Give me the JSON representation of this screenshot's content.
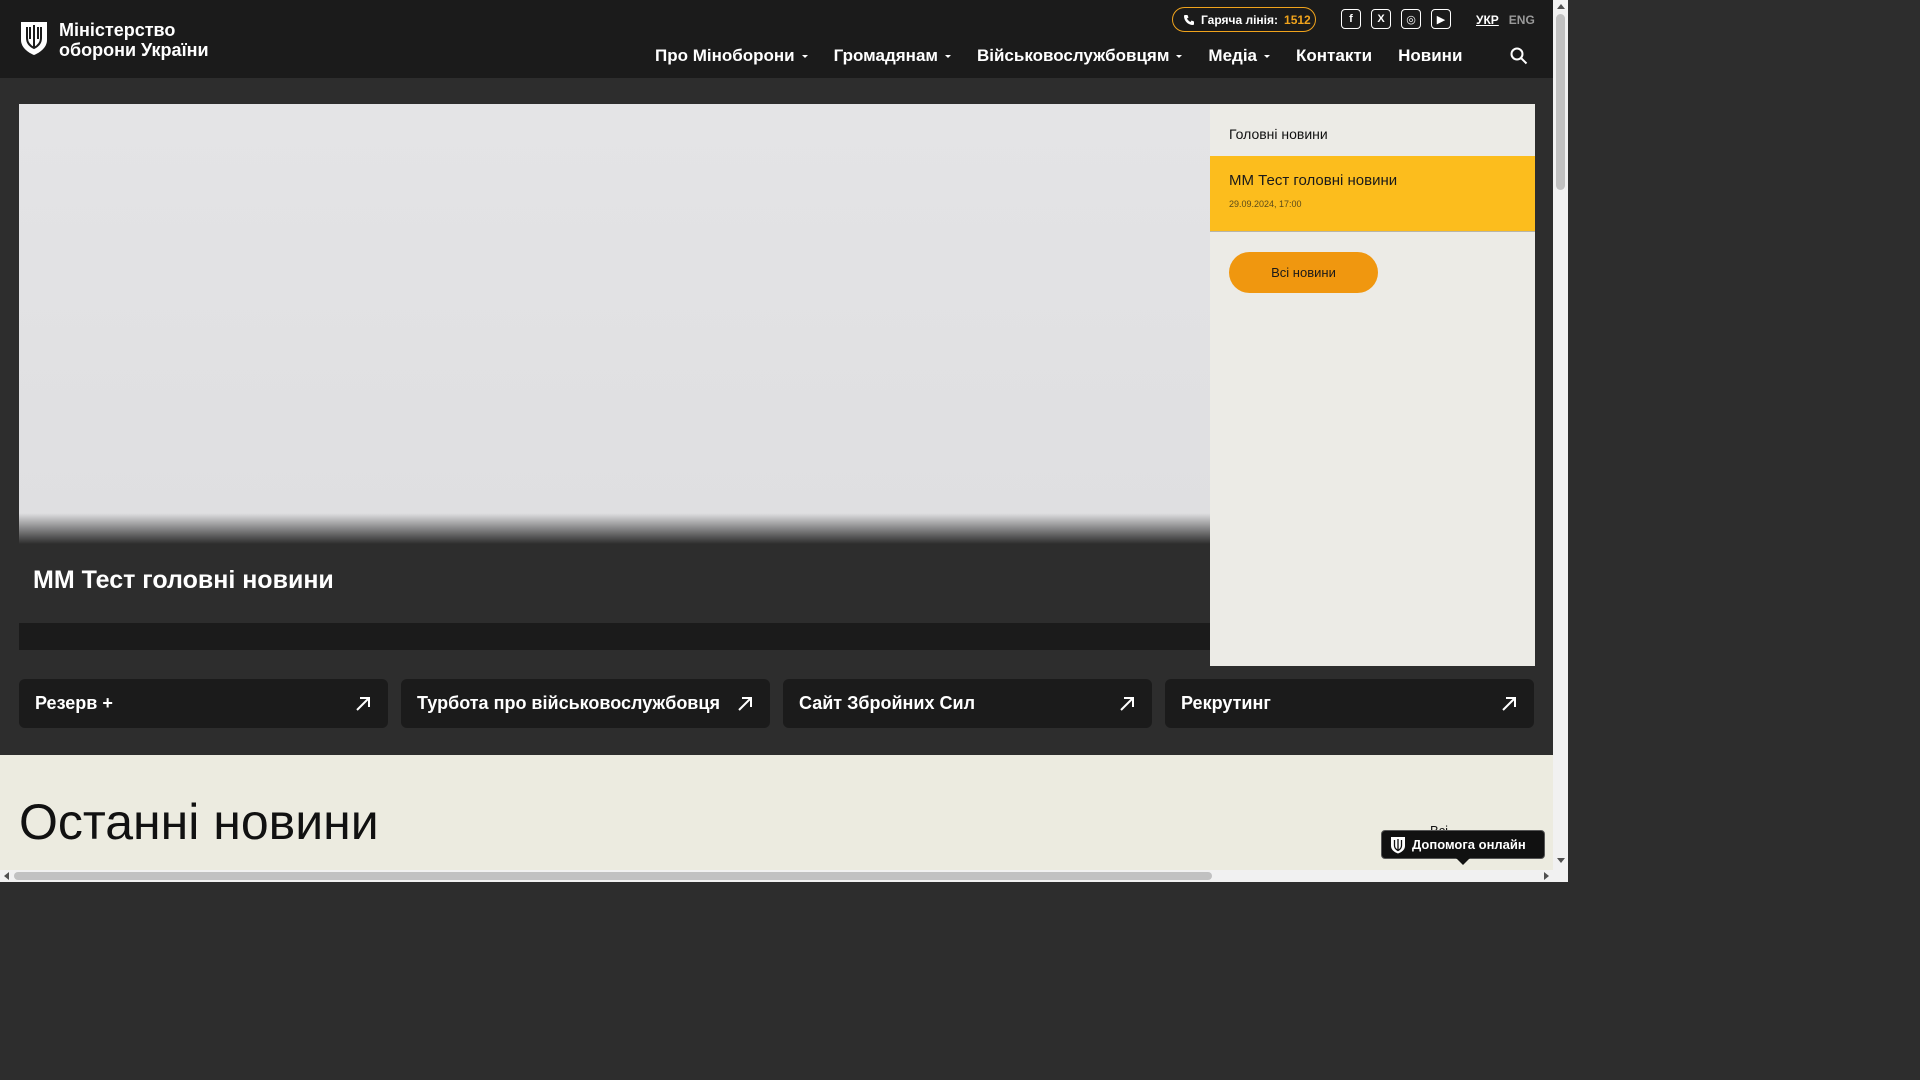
{
  "header": {
    "logo_line1": "Міністерство",
    "logo_line2": "оборони України",
    "hotline_label": "Гаряча лінія:",
    "hotline_number": "1512",
    "social": [
      "f",
      "X",
      "◎",
      "▶"
    ],
    "lang_active": "УКР",
    "lang_other": "ENG",
    "nav": [
      {
        "label": "Про Міноборони",
        "dropdown": true
      },
      {
        "label": "Громадянам",
        "dropdown": true
      },
      {
        "label": "Військовослужбовцям",
        "dropdown": true
      },
      {
        "label": "Медіа",
        "dropdown": true
      },
      {
        "label": "Контакти",
        "dropdown": false
      },
      {
        "label": "Новини",
        "dropdown": false
      }
    ]
  },
  "hero": {
    "title": "ММ Тест головні новини"
  },
  "sidebar": {
    "title": "Головні новини",
    "news_title": "ММ Тест головні новини",
    "news_date": "29.09.2024, 17:00",
    "all_news_button": "Всі новини"
  },
  "quick_links": [
    "Резерв +",
    "Турбота про військовослужбовця",
    "Сайт Збройних Сил",
    "Рекрутинг"
  ],
  "latest": {
    "title": "Останні новини",
    "all_link": "Всі..."
  },
  "help_button": "Допомога онлайн",
  "colors": {
    "accent_yellow": "#fcbd1d",
    "accent_orange": "#f0970f",
    "header_bg": "#1b1b1b"
  }
}
